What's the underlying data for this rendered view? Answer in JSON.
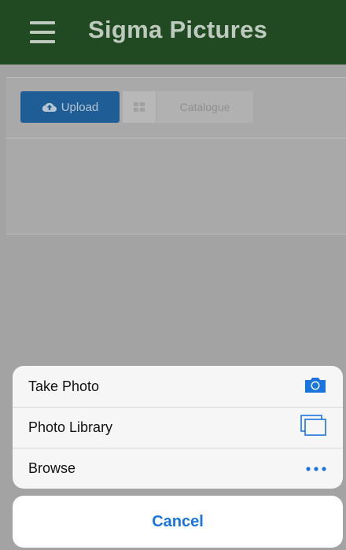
{
  "app": {
    "title": "Sigma Pictures"
  },
  "toolbar": {
    "upload_label": "Upload",
    "catalogue_label": "Catalogue"
  },
  "action_sheet": {
    "options": [
      {
        "label": "Take Photo",
        "icon": "camera-icon"
      },
      {
        "label": "Photo Library",
        "icon": "photo-library-icon"
      },
      {
        "label": "Browse",
        "icon": "more-icon"
      }
    ],
    "cancel_label": "Cancel"
  },
  "colors": {
    "header_bg": "#214a22",
    "upload_bg": "#1f5d96",
    "ios_blue": "#1a74e0"
  }
}
